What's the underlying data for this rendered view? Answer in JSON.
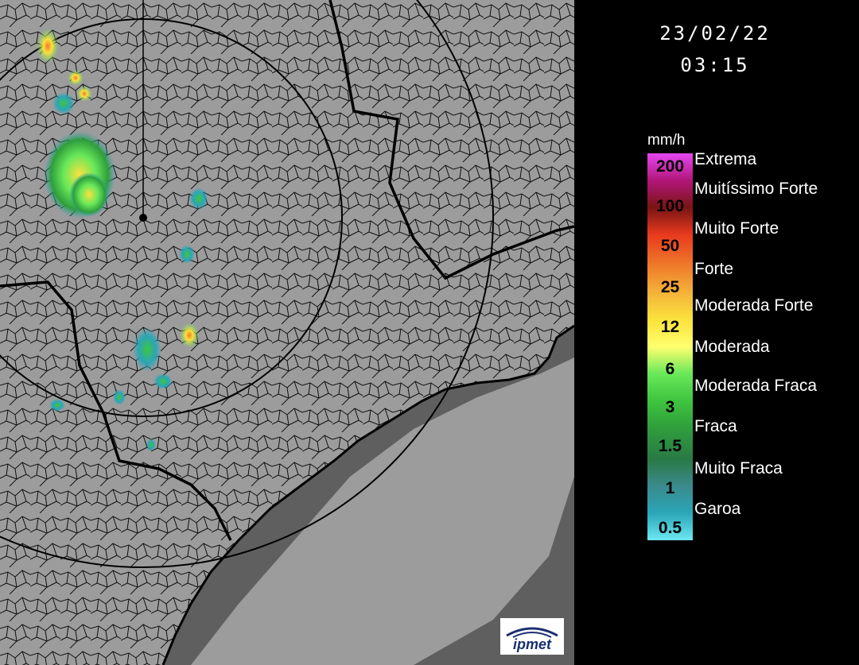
{
  "timestamp": {
    "date": "23/02/22",
    "time": "03:15"
  },
  "legend": {
    "unit": "mm/h",
    "ticks": [
      "200",
      "100",
      "50",
      "25",
      "12",
      "6",
      "3",
      "1.5",
      "1",
      "0.5"
    ],
    "classes": [
      "Extrema",
      "Muitíssimo Forte",
      "Muito Forte",
      "Forte",
      "Moderada Forte",
      "Moderada",
      "Moderada Fraca",
      "Fraca",
      "Muito Fraca",
      "Garoa"
    ],
    "colors": [
      "#e646f2",
      "#b2167a",
      "#7a1414",
      "#e83a1e",
      "#ef7a2a",
      "#f4b23a",
      "#fbe23d",
      "#ffff6e",
      "#68e85a",
      "#3fc43f",
      "#2f9e3c",
      "#2a7a46",
      "#3a8a8c",
      "#2aa6b8",
      "#6ee8f2"
    ]
  },
  "brand": {
    "logo_text": "ipmet"
  },
  "colors": {
    "land": "#9c9c9c",
    "ocean": "#5f5f5f",
    "borders": "#000000"
  }
}
